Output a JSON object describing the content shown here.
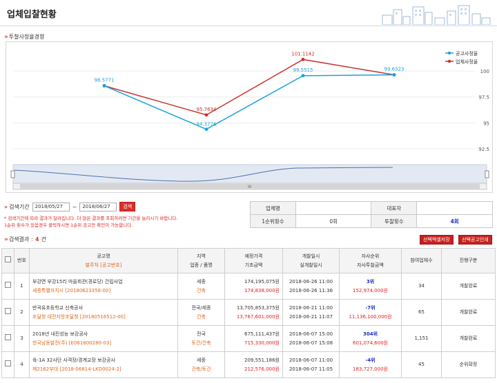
{
  "header": {
    "title": "업체입찰현황"
  },
  "chart_section": {
    "title": "투찰사정율경향"
  },
  "chart_data": {
    "type": "line",
    "x": [
      1,
      2,
      3,
      4
    ],
    "series": [
      {
        "name": "공고사정율",
        "color": "#17a2d8",
        "values": [
          98.5771,
          94.3776,
          99.5515,
          99.6323
        ]
      },
      {
        "name": "업체사정율",
        "color": "#c9302c",
        "values": [
          98.5771,
          95.7634,
          101.1142,
          99.6323
        ]
      }
    ],
    "labels_top": [
      "98.5771",
      "95.7634",
      "101.1142",
      "99.6323"
    ],
    "labels_bottom": [
      "",
      "94.3776",
      "99.5515",
      ""
    ],
    "y_ticks": [
      "100",
      "97.5",
      "95",
      "92.5"
    ],
    "ylim": [
      91.5,
      102
    ],
    "legend_position": "top-right"
  },
  "search": {
    "label": "검색기간",
    "from": "2018/05/27",
    "sep": "~",
    "to": "2018/06/27",
    "button": "검색",
    "notice1": "* 검색기간에 따라 결과가 달라집니다. 더 많은 결과를 조회하려면 기간을 늘리시기 바랍니다.",
    "notice2": "1순위 횟수가 있음경우 클릭하시면 1순위 공고만 확인이 가능합니다."
  },
  "info": {
    "company_label": "업체명",
    "company_value": "",
    "ceo_label": "대표자",
    "ceo_value": "",
    "first_label": "1순위횟수",
    "first_value": "0회",
    "bid_label": "투찰횟수",
    "bid_value": "4회"
  },
  "results": {
    "label": "검색결과",
    "count_sep": ":",
    "count": "4",
    "count_unit": "건",
    "btn_save": "선택엑셀저장",
    "btn_print": "선택공고인쇄",
    "headers": {
      "no": "번호",
      "name": "공고명",
      "name_sub": "발주처 [공고번호]",
      "region": "지역",
      "region_sub": "업종 / 품명",
      "price": "예정가격",
      "price_sub": "기초금액",
      "open": "개찰일시",
      "open_sub": "실개찰일시",
      "rank": "자사순위",
      "rank_sub": "자사투찰금액",
      "participants": "참여업체수",
      "status": "진행구분"
    },
    "rows": [
      {
        "no": "1",
        "name": "부강면 부강15리 마을회관(경로당) 건립사업",
        "org": "세종특별자치시 [20180623358-00]",
        "region": "세종",
        "industry": "건축",
        "price": "174,195,075원",
        "base": "174,838,000원",
        "open": "2018-06-26 11:00",
        "real_open": "2018-06-26 11:36",
        "rank": "3위",
        "bid": "152,974,000원",
        "participants": "34",
        "status": "개찰완료"
      },
      {
        "no": "2",
        "name": "반곡유초등학교 신축공사",
        "org": "조달청 대전지방조달청 [20180516512-00]",
        "region": "전국/세종",
        "industry": "건축",
        "price": "13,705,853,375원",
        "base": "13,767,601,000원",
        "open": "2018-06-21 11:00",
        "real_open": "2018-06-21 11:07",
        "rank": "-7위",
        "bid": "11,136,100,000원",
        "participants": "65",
        "status": "개찰완료"
      },
      {
        "no": "3",
        "name": "2018년 내진성능 보강공사",
        "org": "한국남동발전(주) [E061800280-03]",
        "region": "전국",
        "industry": "토건/건축",
        "price": "675,111,437원",
        "base": "715,330,000원",
        "open": "2018-06-07 15:00",
        "real_open": "2018-06-07 15:08",
        "rank": "304위",
        "bid": "601,074,600원",
        "participants": "1,151",
        "status": "개찰완료"
      },
      {
        "no": "4",
        "name": "육-1A 32사단 사격장/경계교장 보강공사",
        "org": "제2162부대 [2018-06814-LKD0024-2]",
        "region": "세종",
        "industry": "건축/토건",
        "price": "209,551,186원",
        "base": "212,576,000원",
        "open": "2018-06-07 11:00",
        "real_open": "2018-06-07 11:05",
        "rank": "-4위",
        "bid": "183,727,000원",
        "participants": "45",
        "status": "순위확정"
      }
    ]
  }
}
